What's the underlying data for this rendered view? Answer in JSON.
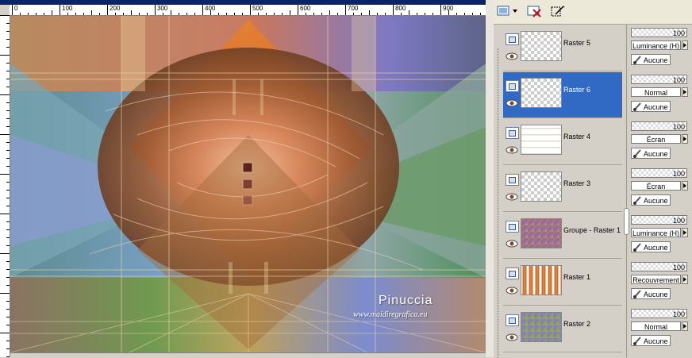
{
  "ruler": {
    "ticks": [
      "0",
      "100",
      "200",
      "300",
      "400",
      "500",
      "600",
      "700",
      "800",
      "900"
    ]
  },
  "watermark": {
    "name": "Pinuccia",
    "url": "www.maidiregrafica.eu"
  },
  "toolbar": {
    "icons": [
      "new-layer-icon",
      "delete-layer-icon",
      "edit-selection-icon"
    ]
  },
  "layers": [
    {
      "name": "Raster 5",
      "opacity": "100",
      "blend": "Luminance (H)",
      "mask": "Aucune",
      "selected": false
    },
    {
      "name": "Raster 6",
      "opacity": "100",
      "blend": "Normal",
      "mask": "Aucune",
      "selected": true
    },
    {
      "name": "Raster 4",
      "opacity": "100",
      "blend": "Écran",
      "mask": "Aucune",
      "selected": false
    },
    {
      "name": "Raster 3",
      "opacity": "100",
      "blend": "Écran",
      "mask": "Aucune",
      "selected": false
    },
    {
      "name": "Groupe - Raster 1",
      "opacity": "100",
      "blend": "Luminance (H)",
      "mask": "Aucune",
      "selected": false
    },
    {
      "name": "Raster 1",
      "opacity": "100",
      "blend": "Recouvrement",
      "mask": "Aucune",
      "selected": false
    },
    {
      "name": "Raster 2",
      "opacity": "100",
      "blend": "Normal",
      "mask": "Aucune",
      "selected": false
    }
  ],
  "colors": {
    "selection": "#316ac5",
    "titlebar": "#0a246a",
    "panel": "#d4d0c8"
  }
}
